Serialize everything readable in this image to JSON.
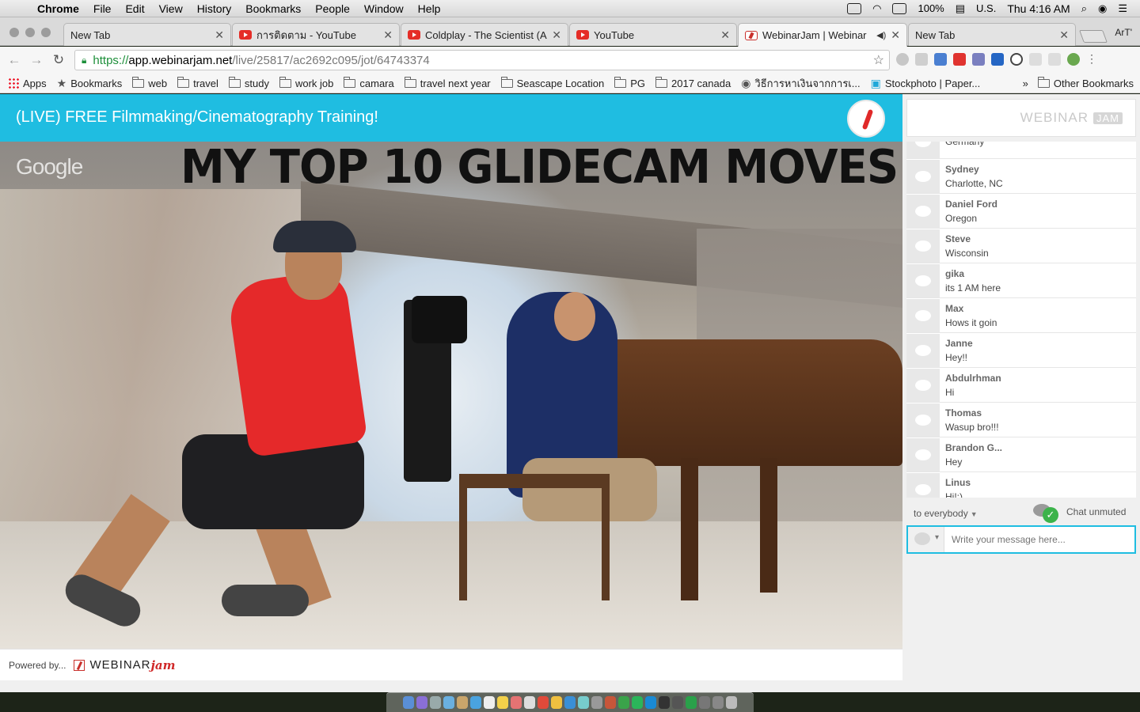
{
  "menubar": {
    "app": "Chrome",
    "items": [
      "File",
      "Edit",
      "View",
      "History",
      "Bookmarks",
      "People",
      "Window",
      "Help"
    ],
    "battery": "100%",
    "input_source": "U.S.",
    "clock": "Thu 4:16 AM"
  },
  "tabs": [
    {
      "title": "New Tab",
      "favicon": "none"
    },
    {
      "title": "การติดตาม - YouTube",
      "favicon": "youtube-icon"
    },
    {
      "title": "Coldplay - The Scientist (Ac",
      "favicon": "youtube-icon"
    },
    {
      "title": "YouTube",
      "favicon": "youtube-icon"
    },
    {
      "title": "WebinarJam | Webinar",
      "favicon": "webinarjam-icon",
      "active": true
    },
    {
      "title": "New Tab",
      "favicon": "none"
    }
  ],
  "profile": "ArT'",
  "address": {
    "scheme": "https://",
    "domain": "app.webinarjam.net",
    "path": "/live/25817/ac2692c095/jot/64743374"
  },
  "bookmarks": [
    "Apps",
    "Bookmarks",
    "web",
    "travel",
    "study",
    "work job",
    "camara",
    "travel next year",
    "Seascape Location",
    "PG",
    "2017 canada",
    "วิธีการหาเงินจากการเ...",
    "Stockphoto | Paper..."
  ],
  "bookmarks_overflow": "»",
  "other_bookmarks": "Other Bookmarks",
  "webinar": {
    "title": "(LIVE) FREE Filmmaking/Cinematography Training!",
    "video_headline": "MY TOP 10 GLIDECAM MOVES",
    "video_watermark": "Google",
    "powered_by": "Powered by...",
    "footer_brand": "WEBINAR",
    "footer_brand_accent": "jam"
  },
  "chat": {
    "brand": "WEBINAR",
    "brand_badge": "JAM",
    "messages": [
      {
        "name": "",
        "text": "Germany"
      },
      {
        "name": "Sydney",
        "text": "Charlotte, NC"
      },
      {
        "name": "Daniel Ford",
        "text": "Oregon"
      },
      {
        "name": "Steve",
        "text": "Wisconsin"
      },
      {
        "name": "gika",
        "text": "its 1 AM here"
      },
      {
        "name": "Max",
        "text": "Hows it goin"
      },
      {
        "name": "Janne",
        "text": "Hey!!"
      },
      {
        "name": "Abdulrhman",
        "text": "Hi"
      },
      {
        "name": "Thomas",
        "text": "Wasup bro!!!"
      },
      {
        "name": "Brandon G...",
        "text": "Hey"
      },
      {
        "name": "Linus",
        "text": "Hi!:)"
      }
    ],
    "recipient": "to everybody",
    "status": "Chat unmuted",
    "placeholder": "Write your message here..."
  },
  "colors": {
    "header": "#1fbde1",
    "accent_red": "#d02828",
    "ssl_green": "#1d8f3a"
  }
}
